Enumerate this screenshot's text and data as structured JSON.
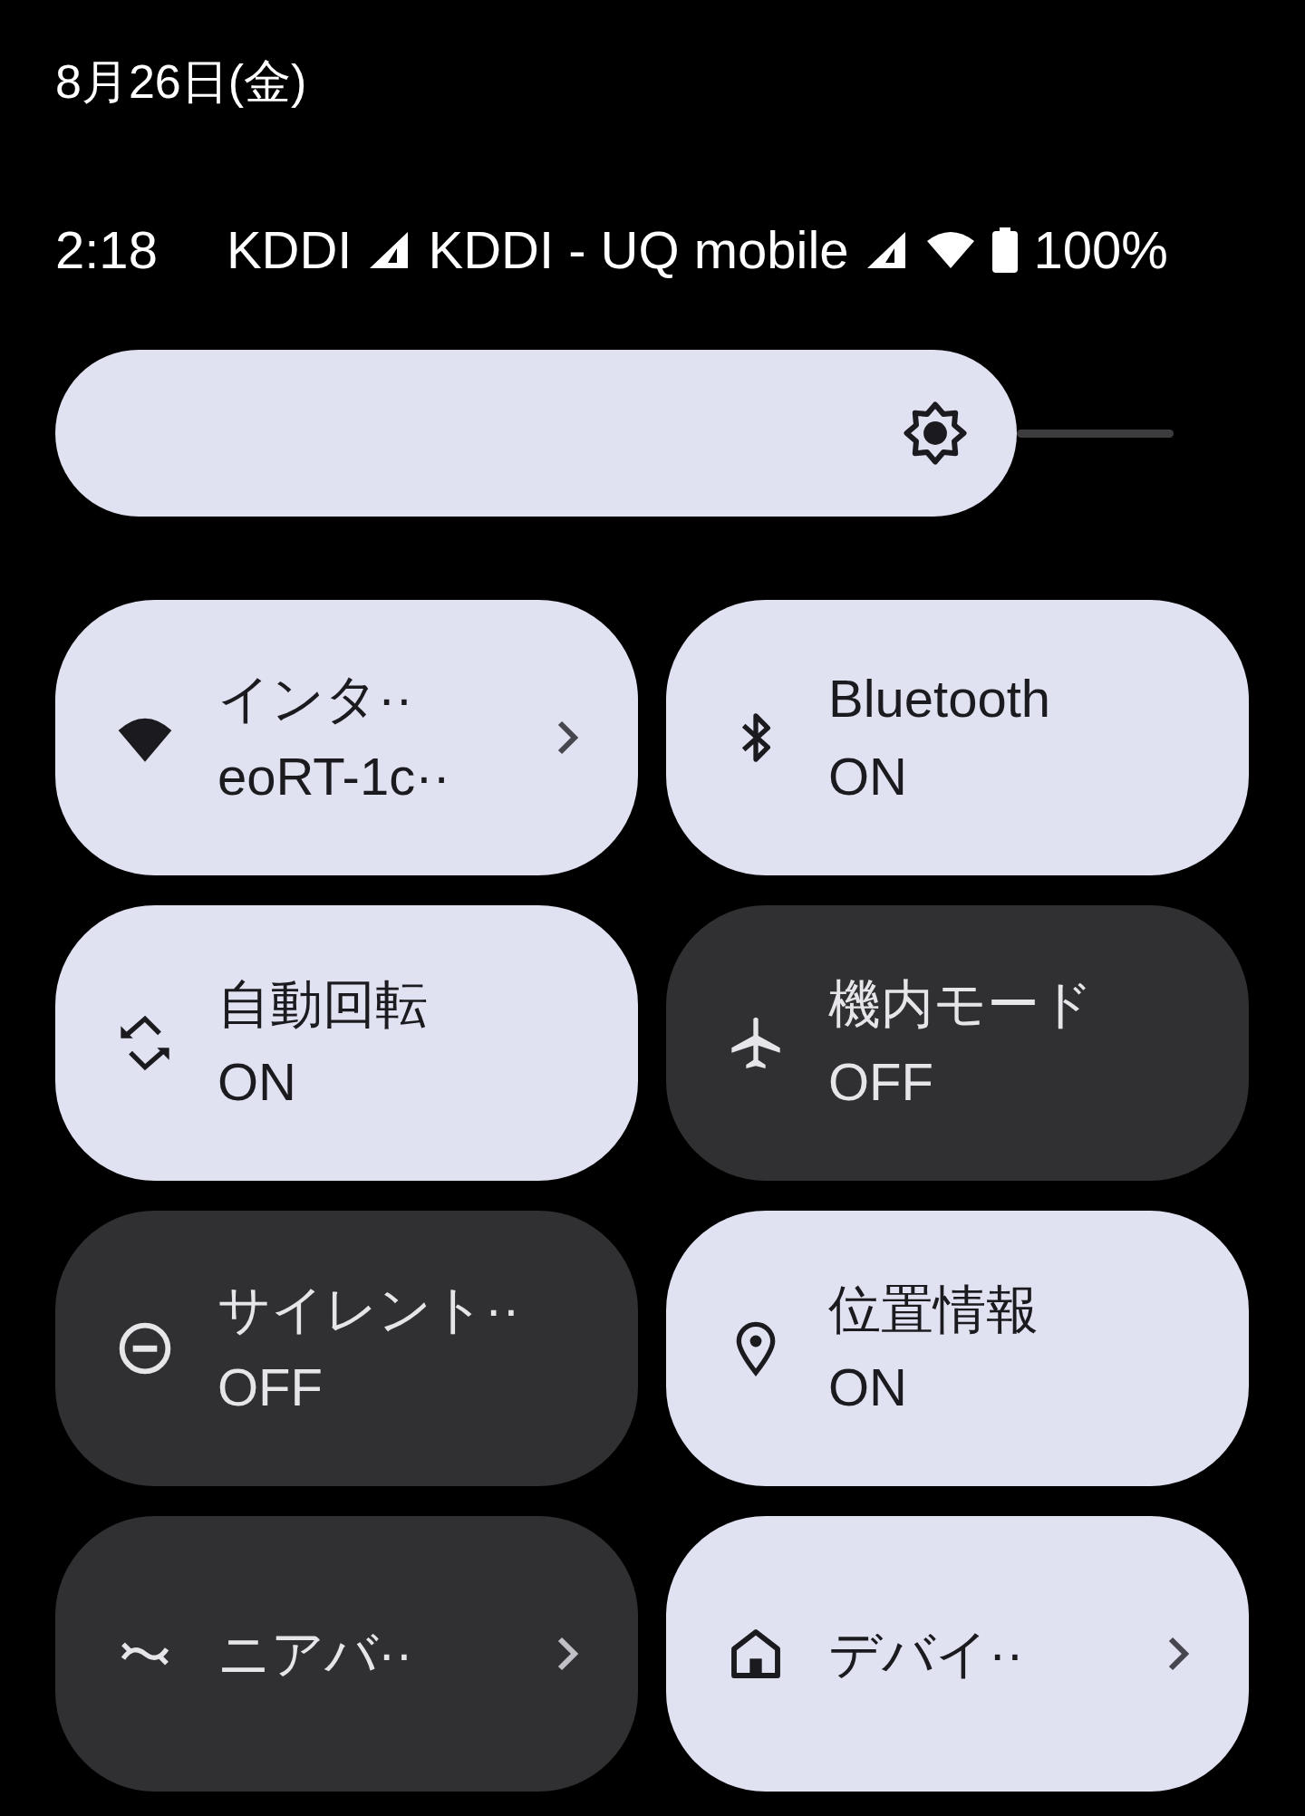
{
  "date": "8月26日(金)",
  "status_bar": {
    "time": "2:18",
    "carriers": [
      {
        "name": "KDDI"
      },
      {
        "name": "KDDI - UQ mobile"
      }
    ],
    "battery": "100%"
  },
  "brightness": {
    "level": 0.86
  },
  "tiles": [
    {
      "kind": "wifi",
      "title": "インタ··",
      "subtitle": "eoRT-1c··",
      "on": true,
      "chevron": true
    },
    {
      "kind": "bluetooth",
      "title": "Bluetooth",
      "subtitle": "ON",
      "on": true,
      "chevron": false
    },
    {
      "kind": "rotate",
      "title": "自動回転",
      "subtitle": "ON",
      "on": true,
      "chevron": false
    },
    {
      "kind": "airplane",
      "title": "機内モード",
      "subtitle": "OFF",
      "on": false,
      "chevron": false
    },
    {
      "kind": "dnd",
      "title": "サイレント··",
      "subtitle": "OFF",
      "on": false,
      "chevron": false
    },
    {
      "kind": "location",
      "title": "位置情報",
      "subtitle": "ON",
      "on": true,
      "chevron": false
    },
    {
      "kind": "nearby",
      "title": "ニアバ··",
      "on": false,
      "chevron": true
    },
    {
      "kind": "home",
      "title": "デバイ··",
      "on": true,
      "chevron": true
    }
  ]
}
